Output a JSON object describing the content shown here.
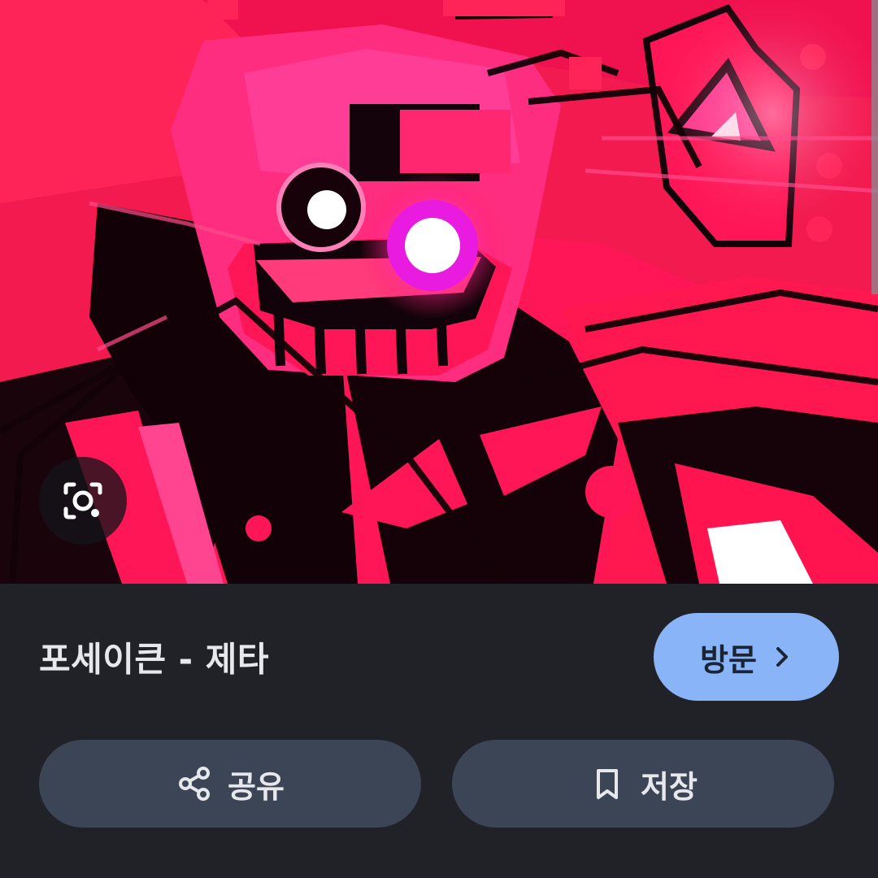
{
  "preview": {
    "image_description_icon": "glitch-character-artwork",
    "lens_icon": "google-lens-icon"
  },
  "result": {
    "title": "포세이큰 - 제타",
    "visit_label": "방문",
    "visit_icon": "chevron-right-icon"
  },
  "actions": {
    "share_label": "공유",
    "share_icon": "share-icon",
    "save_label": "저장",
    "save_icon": "bookmark-icon"
  },
  "colors": {
    "sheet_background": "#202227",
    "visit_button": "#8ab4f8",
    "action_button": "#3c4556",
    "artwork_accent": "#ff1656"
  }
}
